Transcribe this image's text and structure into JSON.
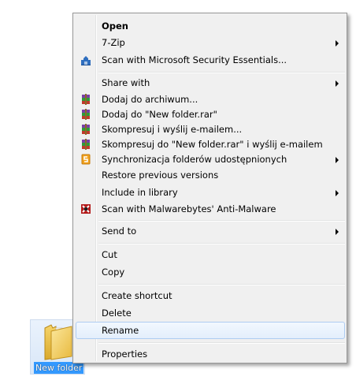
{
  "context_menu": {
    "items": [
      {
        "label": "Open",
        "icon": "",
        "submenu": false,
        "bold": true
      },
      {
        "label": "7-Zip",
        "icon": "",
        "submenu": true
      },
      {
        "label": "Scan with Microsoft Security Essentials...",
        "icon": "security-essentials-icon",
        "submenu": false
      },
      {
        "label": "Share with",
        "icon": "",
        "submenu": true
      },
      {
        "label": "Dodaj do archiwum...",
        "icon": "winrar-icon",
        "submenu": false
      },
      {
        "label": "Dodaj do \"New folder.rar\"",
        "icon": "winrar-icon",
        "submenu": false
      },
      {
        "label": "Skompresuj i wyślij e-mailem...",
        "icon": "winrar-icon",
        "submenu": false
      },
      {
        "label": "Skompresuj do \"New folder.rar\" i wyślij e-mailem",
        "icon": "winrar-icon",
        "submenu": false
      },
      {
        "label": "Synchronizacja folderów udostępnionych",
        "icon": "sync-icon",
        "submenu": true
      },
      {
        "label": "Restore previous versions",
        "icon": "",
        "submenu": false
      },
      {
        "label": "Include in library",
        "icon": "",
        "submenu": true
      },
      {
        "label": "Scan with Malwarebytes' Anti-Malware",
        "icon": "malwarebytes-icon",
        "submenu": false
      },
      {
        "label": "Send to",
        "icon": "",
        "submenu": true
      },
      {
        "label": "Cut",
        "icon": "",
        "submenu": false
      },
      {
        "label": "Copy",
        "icon": "",
        "submenu": false
      },
      {
        "label": "Create shortcut",
        "icon": "",
        "submenu": false
      },
      {
        "label": "Delete",
        "icon": "",
        "submenu": false
      },
      {
        "label": "Rename",
        "icon": "",
        "submenu": false,
        "highlighted": true
      },
      {
        "label": "Properties",
        "icon": "",
        "submenu": false
      }
    ]
  },
  "desktop": {
    "folder_label": "New folder",
    "folder_icon": "folder-icon",
    "selection_color": "#3399ff"
  }
}
